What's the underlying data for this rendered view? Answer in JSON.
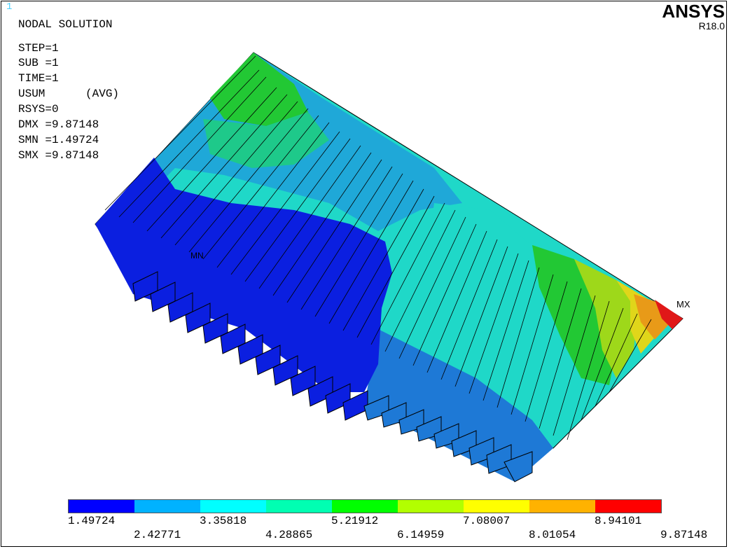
{
  "window_number": "1",
  "logo": {
    "brand": "ANSYS",
    "release": "R18.0"
  },
  "info": {
    "title": "NODAL SOLUTION",
    "step": "STEP=1",
    "sub": "SUB =1",
    "time": "TIME=1",
    "usum": "USUM      (AVG)",
    "rsys": "RSYS=0",
    "dmx": "DMX =9.87148",
    "smn": "SMN =1.49724",
    "smx": "SMX =9.87148"
  },
  "markers": {
    "min": "MN",
    "max": "MX"
  },
  "legend": {
    "colors": [
      "#0000ff",
      "#00b2ff",
      "#00ffff",
      "#00ffb2",
      "#00ff00",
      "#b2ff00",
      "#ffff00",
      "#ffb200",
      "#ff0000"
    ],
    "values_top": [
      "1.49724",
      "3.35818",
      "5.21912",
      "7.08007",
      "8.94101"
    ],
    "values_bottom": [
      "2.42771",
      "4.28865",
      "6.14959",
      "8.01054",
      "9.87148"
    ]
  },
  "contour_colors": {
    "dark_blue": "#0b1fe0",
    "blue": "#1e79d6",
    "light_blue": "#1fa8d8",
    "cyan": "#1fd8c8",
    "teal_green": "#1ec98a",
    "green": "#22c834",
    "yellow_green": "#9ed81a",
    "yellow": "#e0d61a",
    "orange": "#e89a18",
    "red": "#e01818"
  }
}
